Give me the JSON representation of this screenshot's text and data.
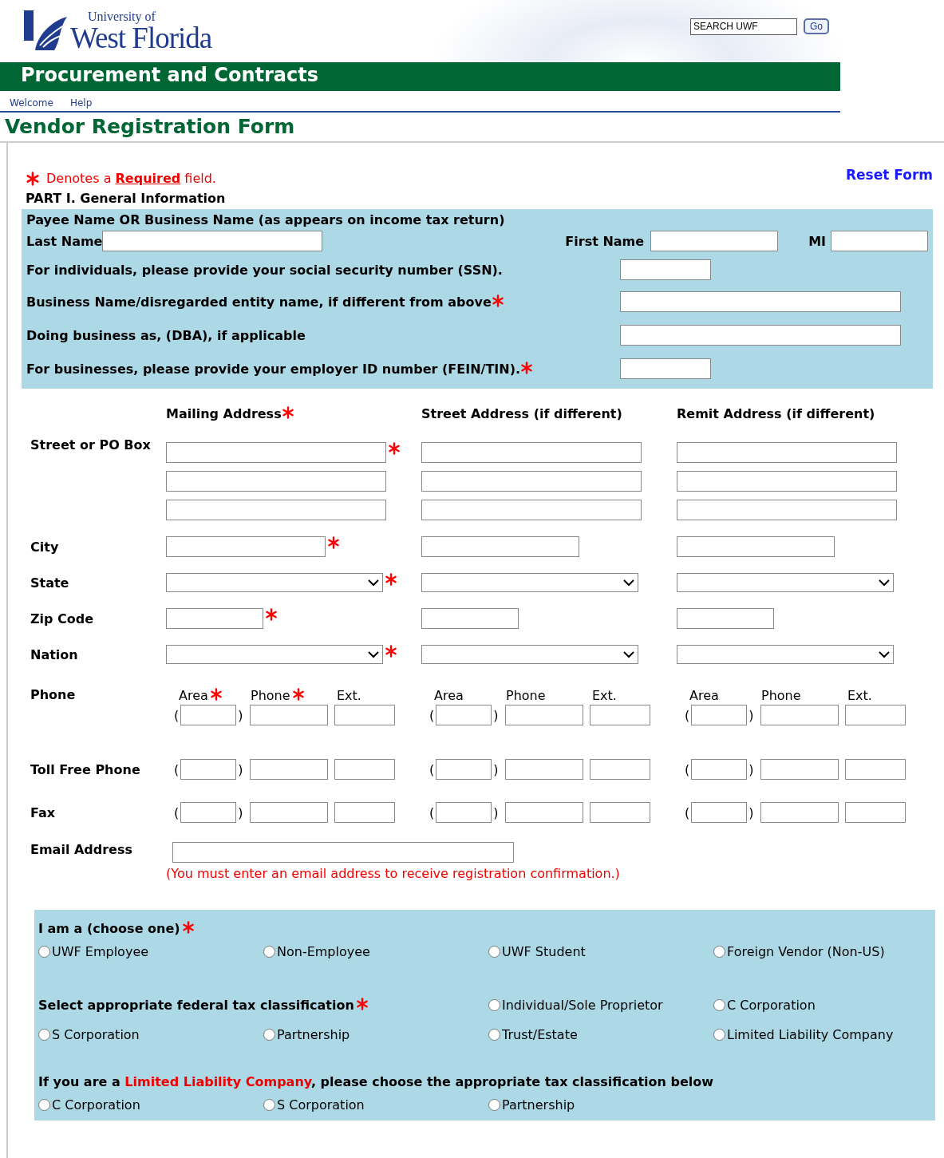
{
  "header": {
    "logo_small": "University of",
    "logo_big": "West Florida",
    "search": {
      "value": "SEARCH UWF"
    },
    "go_button": "Go"
  },
  "banner": "Procurement and Contracts",
  "nav": [
    {
      "label": "Welcome"
    },
    {
      "label": "Help"
    }
  ],
  "page_title": "Vendor Registration Form",
  "required_note": "Denotes a **Required** field.",
  "reset_link": "Reset Form",
  "part1": {
    "title": "PART I. General Information",
    "heading": "Payee Name OR Business Name (as appears on income tax return)",
    "name_fields": [
      {
        "label": "Last Name"
      },
      {
        "label": "First Name"
      },
      {
        "label": "MI"
      }
    ],
    "rows": [
      {
        "label": "For individuals, please provide your social security number (SSN).",
        "required": false,
        "kind": "short"
      },
      {
        "label": "Business Name/disregarded entity name, if different from above",
        "required": true,
        "kind": "long"
      },
      {
        "label": "Doing business as, (DBA), if applicable",
        "required": false,
        "kind": "long"
      },
      {
        "label": "For businesses, please provide your employer ID number (FEIN/TIN).",
        "required": true,
        "kind": "short"
      }
    ]
  },
  "address": {
    "columns": [
      {
        "heading": "Mailing Address",
        "required": true
      },
      {
        "heading": "Street Address (if different)",
        "required": false
      },
      {
        "heading": "Remit Address (if different)",
        "required": false
      }
    ],
    "rows": [
      {
        "label": "Street or PO Box",
        "kind": "street",
        "required": true
      },
      {
        "label": "City",
        "kind": "city",
        "required": true
      },
      {
        "label": "State",
        "kind": "select",
        "required": true
      },
      {
        "label": "Zip Code",
        "kind": "zip",
        "required": true
      },
      {
        "label": "Nation",
        "kind": "select",
        "required": true
      }
    ]
  },
  "phones": {
    "headers": [
      {
        "area": "Area",
        "phone": "Phone",
        "ext": "Ext."
      },
      {
        "area": "Area",
        "phone": "Phone",
        "ext": "Ext."
      },
      {
        "area": "Area",
        "phone": "Phone",
        "ext": "Ext."
      }
    ],
    "rows": [
      {
        "label": "Phone",
        "cells": [
          {
            "open": "(",
            "close": ")"
          },
          {
            "open": "(",
            "close": ")"
          },
          {
            "open": "(",
            "close": ")"
          }
        ]
      },
      {
        "label": "Toll Free Phone",
        "cells": [
          {
            "open": "(",
            "close": ")"
          },
          {
            "open": "(",
            "close": ")"
          },
          {
            "open": "(",
            "close": ")"
          }
        ]
      },
      {
        "label": "Fax",
        "cells": [
          {
            "open": "(",
            "close": ")"
          },
          {
            "open": "(",
            "close": ")"
          },
          {
            "open": "(",
            "close": ")"
          }
        ]
      }
    ]
  },
  "email": {
    "label": "Email Address",
    "note": "(You must enter an email address to receive registration confirmation.)"
  },
  "vendor_type": {
    "label": "I am a (choose one)",
    "required": true,
    "options": [
      {
        "label": "UWF Employee",
        "selected": false
      },
      {
        "label": "Non-Employee",
        "selected": false
      },
      {
        "label": "UWF Student",
        "selected": false
      },
      {
        "label": "Foreign Vendor (Non-US)",
        "selected": false
      }
    ]
  },
  "tax_class": {
    "label": "Select appropriate federal tax classification",
    "required": true,
    "options": [
      {
        "label": "Individual/Sole Proprietor",
        "selected": false
      },
      {
        "label": "C Corporation",
        "selected": false
      },
      {
        "label": "S Corporation",
        "selected": false
      },
      {
        "label": "Partnership",
        "selected": false
      },
      {
        "label": "Trust/Estate",
        "selected": false
      },
      {
        "label": "Limited Liability Company",
        "selected": false
      }
    ]
  },
  "llc": {
    "label_before": "If you are a ",
    "label_highlight": "Limited Liability Company",
    "label_after": ", please choose the appropriate tax classification below",
    "options": [
      {
        "label": "C Corporation",
        "selected": false
      },
      {
        "label": "S Corporation",
        "selected": false
      },
      {
        "label": "Partnership",
        "selected": false
      }
    ]
  }
}
